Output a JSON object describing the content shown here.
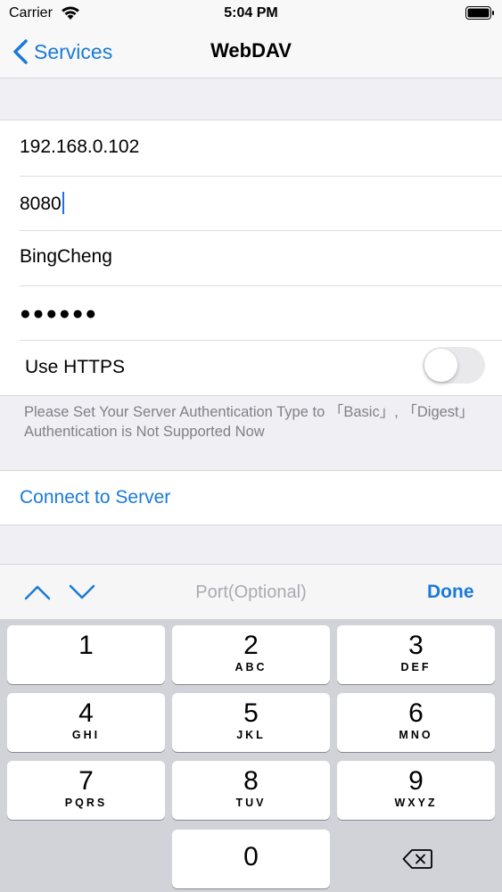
{
  "status_bar": {
    "carrier": "Carrier",
    "time": "5:04 PM"
  },
  "nav": {
    "back_label": "Services",
    "title": "WebDAV"
  },
  "form": {
    "host": "192.168.0.102",
    "port": "8080",
    "username": "BingCheng",
    "password_masked": "●●●●●●",
    "https_label": "Use HTTPS",
    "https_enabled": false
  },
  "footer_note": "Please Set Your Server Authentication Type to 「Basic」, 「Digest」Authentication is Not Supported Now",
  "connect_label": "Connect to Server",
  "accessory": {
    "field_hint": "Port(Optional)",
    "done_label": "Done"
  },
  "keypad": {
    "keys": [
      {
        "digit": "1",
        "letters": ""
      },
      {
        "digit": "2",
        "letters": "ABC"
      },
      {
        "digit": "3",
        "letters": "DEF"
      },
      {
        "digit": "4",
        "letters": "GHI"
      },
      {
        "digit": "5",
        "letters": "JKL"
      },
      {
        "digit": "6",
        "letters": "MNO"
      },
      {
        "digit": "7",
        "letters": "PQRS"
      },
      {
        "digit": "8",
        "letters": "TUV"
      },
      {
        "digit": "9",
        "letters": "WXYZ"
      },
      {
        "digit": "0",
        "letters": ""
      }
    ]
  },
  "colors": {
    "accent": "#1a7ad9",
    "background": "#efeff4",
    "keypad_bg": "#d1d3d9"
  },
  "icons": [
    "wifi-icon",
    "battery-icon",
    "chevron-left-icon",
    "chevron-up-icon",
    "chevron-down-icon",
    "delete-backspace-icon"
  ]
}
